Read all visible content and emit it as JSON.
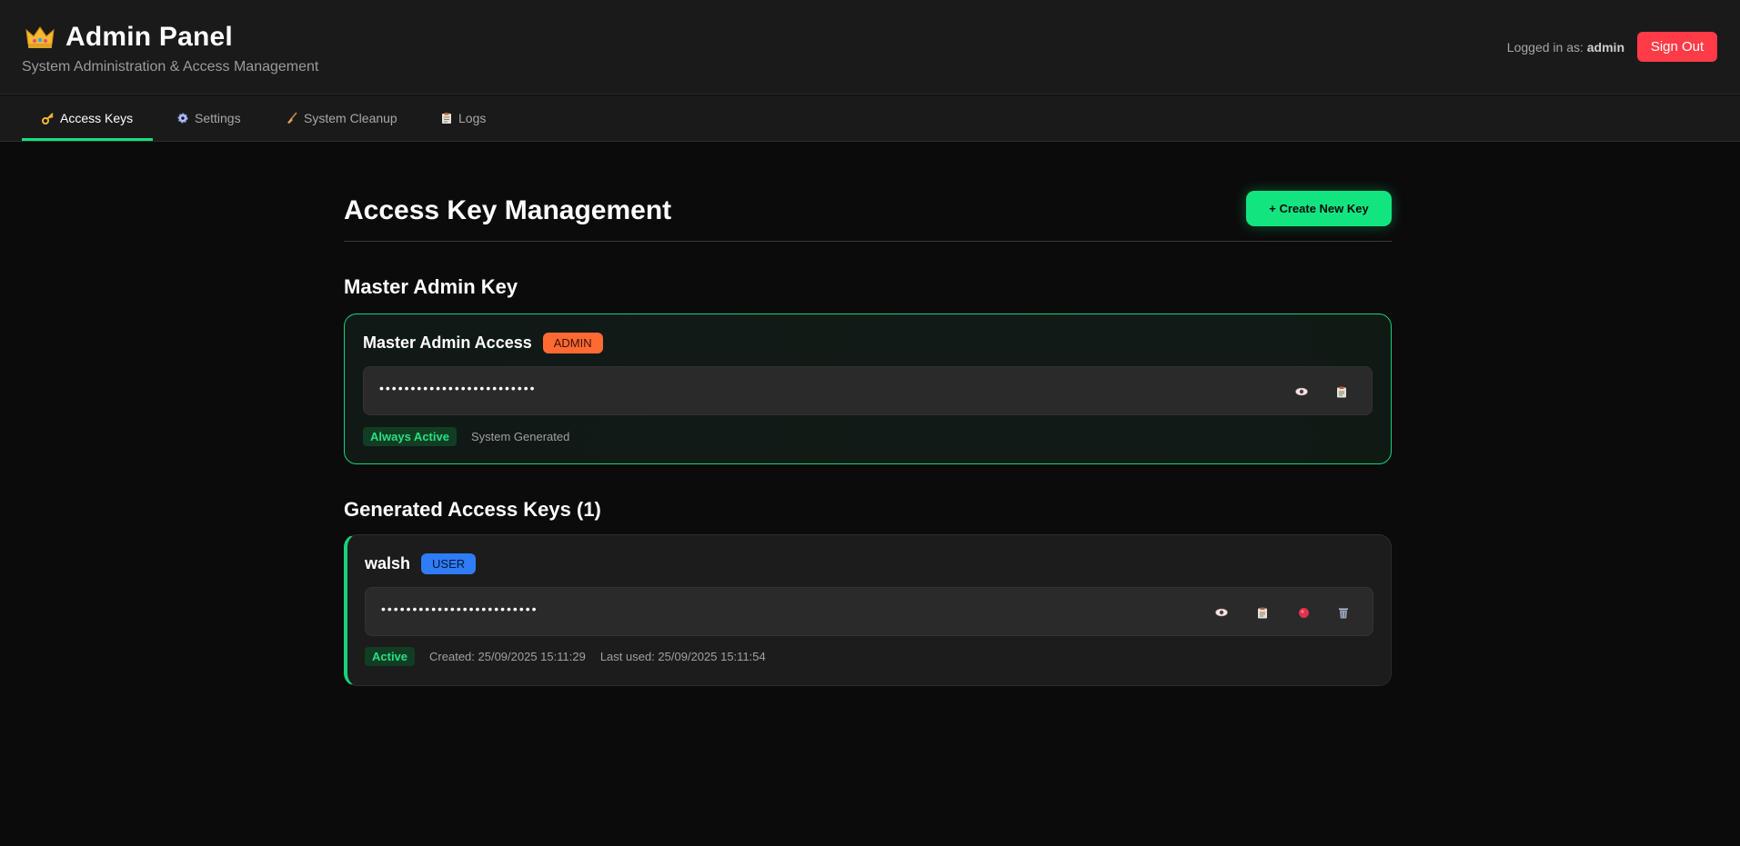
{
  "header": {
    "title": "Admin Panel",
    "subtitle": "System Administration & Access Management",
    "logged_prefix": "Logged in as:",
    "username": "admin",
    "signout_label": "Sign Out",
    "icon": "crown-icon"
  },
  "tabs": [
    {
      "label": "Access Keys",
      "icon": "key-icon",
      "active": true
    },
    {
      "label": "Settings",
      "icon": "gear-icon",
      "active": false
    },
    {
      "label": "System Cleanup",
      "icon": "broom-icon",
      "active": false
    },
    {
      "label": "Logs",
      "icon": "clipboard-icon",
      "active": false
    }
  ],
  "main": {
    "title": "Access Key Management",
    "create_label": "+ Create New Key",
    "master_section_title": "Master Admin Key",
    "master": {
      "name": "Master Admin Access",
      "role": "ADMIN",
      "masked_key": "•••••••••••••••••••••••••",
      "status": "Always Active",
      "source": "System Generated"
    },
    "generated_section_title": "Generated Access Keys (1)",
    "keys": [
      {
        "name": "walsh",
        "role": "USER",
        "masked_key": "•••••••••••••••••••••••••",
        "status": "Active",
        "created": "Created: 25/09/2025 15:11:29",
        "last_used": "Last used: 25/09/2025 15:11:54"
      }
    ]
  },
  "colors": {
    "accent": "#12e580",
    "danger": "#ff3b47",
    "admin_badge": "#ff6a33",
    "user_badge": "#2e7cf6",
    "background": "#0b0b0b",
    "surface": "#1a1a1a"
  }
}
